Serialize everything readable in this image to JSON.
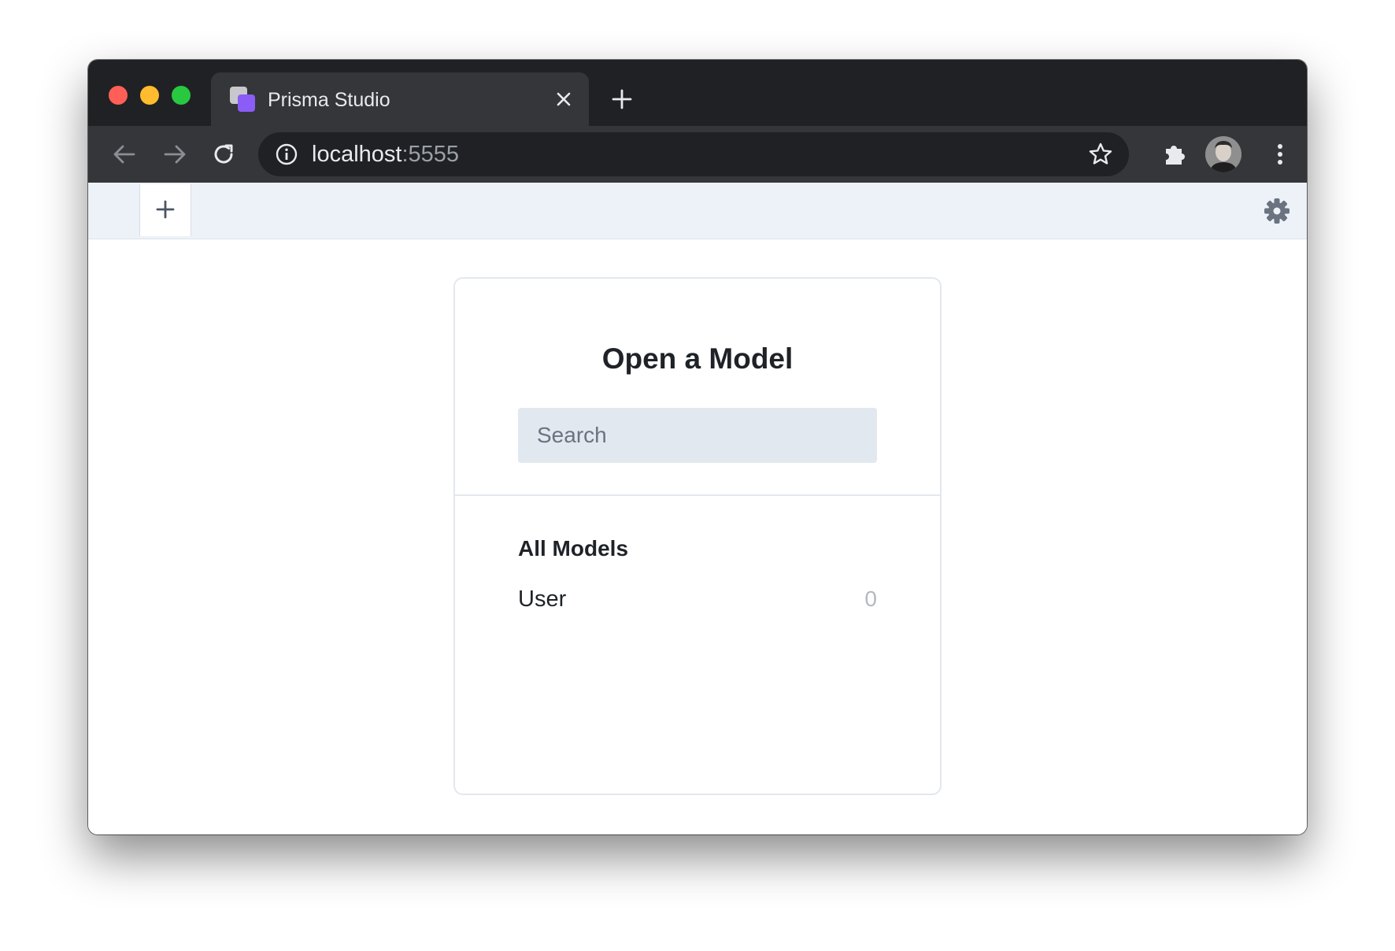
{
  "browser": {
    "tab_title": "Prisma Studio",
    "url_host": "localhost",
    "url_port": ":5555"
  },
  "app": {
    "card_title": "Open a Model",
    "search": {
      "placeholder": "Search",
      "value": ""
    },
    "section_label": "All Models",
    "models": [
      {
        "name": "User",
        "count": "0"
      }
    ]
  },
  "colors": {
    "favicon_accent": "#8b5cf6",
    "tabbar_bg": "#edf2f8",
    "search_bg": "#e2e8f0"
  },
  "icons": [
    "close-icon",
    "plus-icon",
    "back-arrow-icon",
    "forward-arrow-icon",
    "reload-icon",
    "info-icon",
    "star-icon",
    "puzzle-icon",
    "kebab-menu-icon",
    "gear-icon"
  ]
}
